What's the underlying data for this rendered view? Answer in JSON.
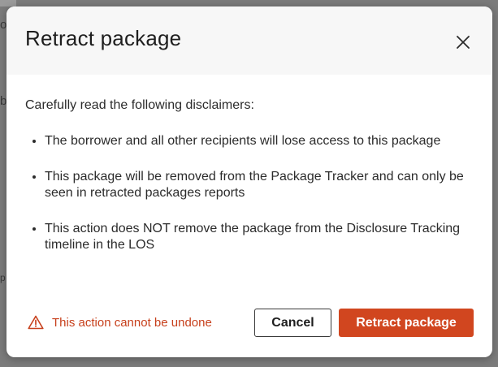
{
  "dialog": {
    "title": "Retract package",
    "close_icon": "close-icon",
    "intro": "Carefully read the following disclaimers:",
    "disclaimers": [
      "The borrower and all other recipients will lose access to this package",
      "This package will be removed from the Package Tracker and can only be seen in retracted packages reports",
      "This action does NOT remove the package from the Disclosure Tracking timeline in the LOS"
    ],
    "warning": {
      "icon": "warning-triangle-icon",
      "text": "This action cannot be undone"
    },
    "cancel_label": "Cancel",
    "confirm_label": "Retract package"
  },
  "background": {
    "letters": [
      "o",
      "b",
      "p"
    ]
  },
  "colors": {
    "accent": "#d1461f",
    "warning_text": "#c7401c",
    "overlay": "#7b7b7b",
    "header_bg": "#f7f7f7"
  }
}
